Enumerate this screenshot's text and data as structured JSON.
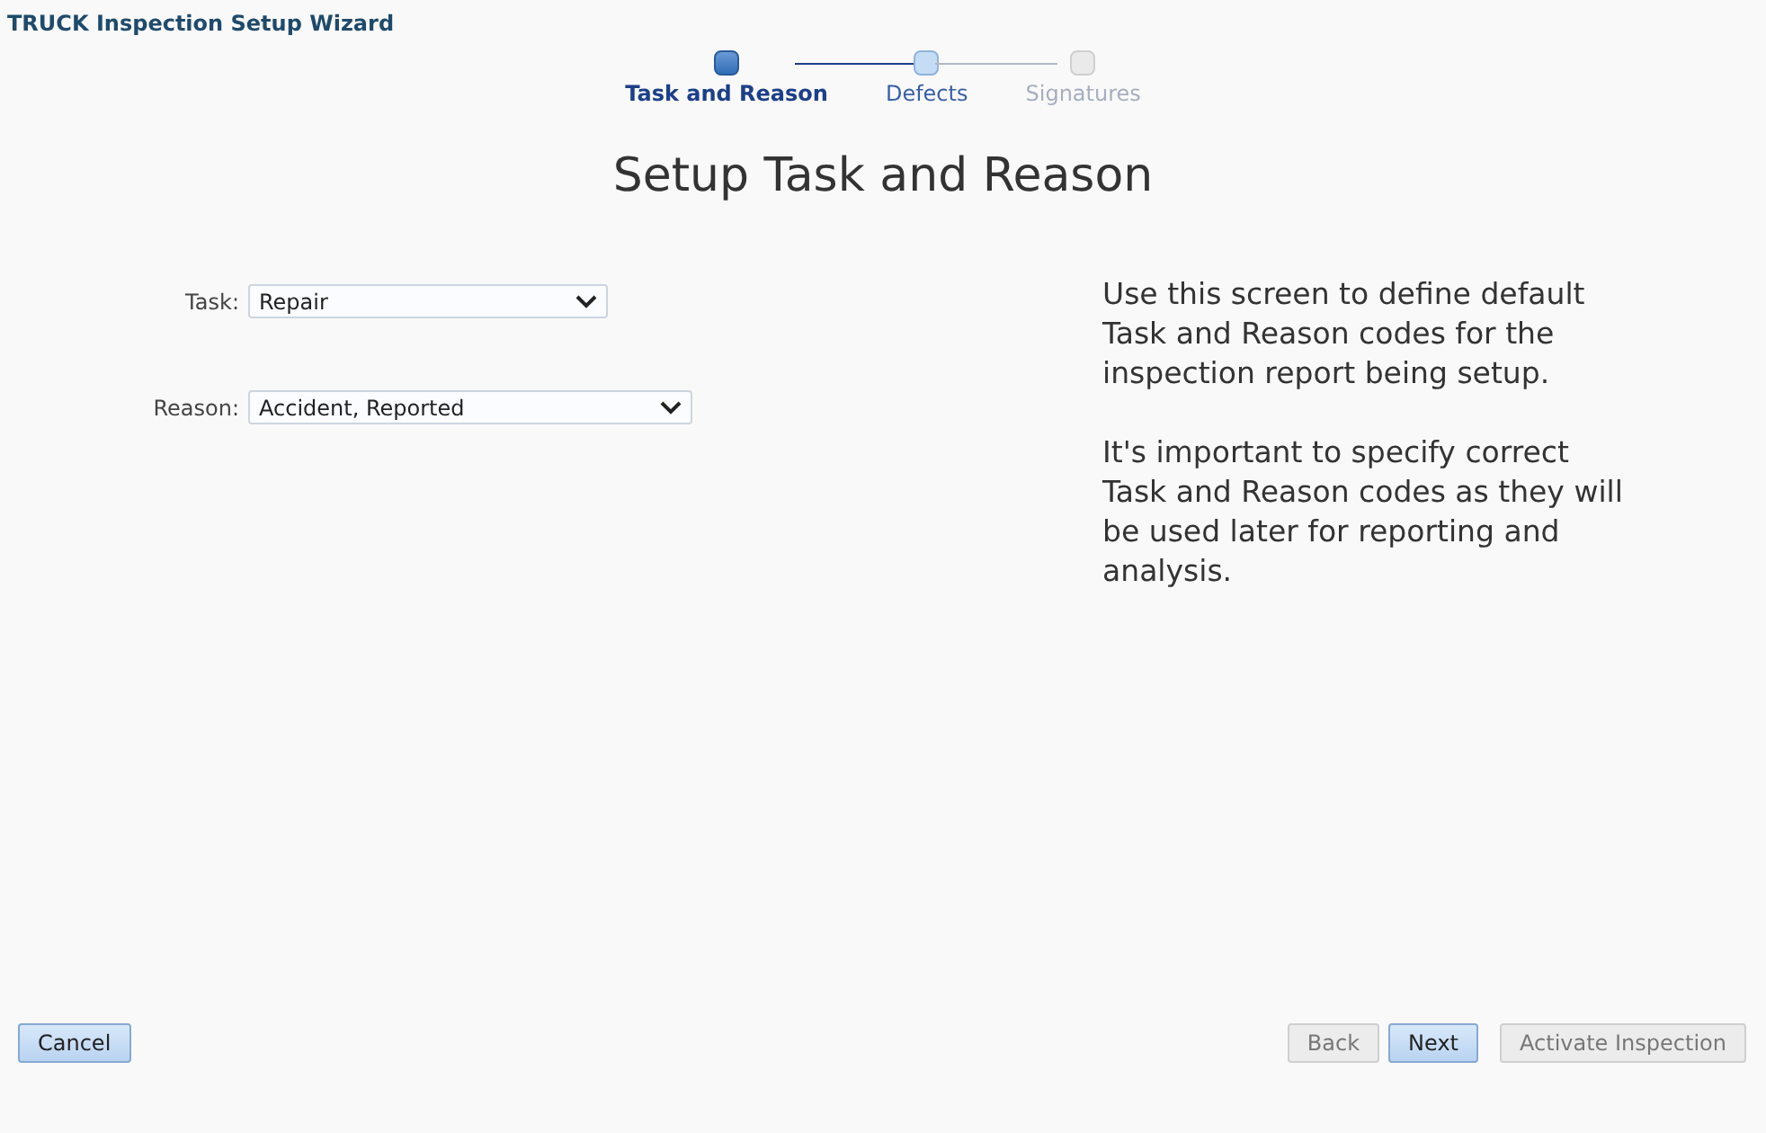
{
  "window": {
    "title": "TRUCK Inspection Setup Wizard"
  },
  "steps": [
    {
      "label": "Task and Reason",
      "selected": true,
      "disabled": false
    },
    {
      "label": "Defects",
      "selected": false,
      "disabled": false
    },
    {
      "label": "Signatures",
      "selected": false,
      "disabled": true
    }
  ],
  "heading": "Setup Task and Reason",
  "fields": [
    {
      "label": "Task:",
      "value": "Repair"
    },
    {
      "label": "Reason:",
      "value": "Accident, Reported"
    }
  ],
  "help": [
    "Use this screen to define default Task and Reason codes for the inspection report being setup.",
    "It's important to specify correct Task and Reason codes as they will be used later for reporting and analysis."
  ],
  "buttons_left": [
    {
      "label": "Cancel",
      "disabled": false
    }
  ],
  "buttons_right": [
    {
      "label": "Back",
      "disabled": true
    },
    {
      "label": "Next",
      "disabled": false
    },
    {
      "label": "Activate Inspection",
      "disabled": true
    }
  ]
}
